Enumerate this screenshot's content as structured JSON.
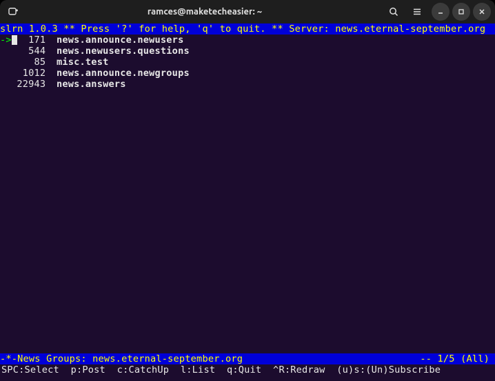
{
  "window": {
    "title": "ramces@maketecheasier: ~"
  },
  "header": "slrn 1.0.3 ** Press '?' for help, 'q' to quit. ** Server: news.eternal-september.org",
  "groups": [
    {
      "arrow": "->",
      "count": "171",
      "name": "news.announce.newusers",
      "cursor": true
    },
    {
      "arrow": "",
      "count": "544",
      "name": "news.newusers.questions",
      "cursor": false
    },
    {
      "arrow": "",
      "count": "85",
      "name": "misc.test",
      "cursor": false
    },
    {
      "arrow": "",
      "count": "1012",
      "name": "news.announce.newgroups",
      "cursor": false
    },
    {
      "arrow": "",
      "count": "22943",
      "name": "news.answers",
      "cursor": false
    }
  ],
  "status": {
    "left": "-*-News Groups: news.eternal-september.org",
    "right": "-- 1/5 (All)"
  },
  "help": "SPC:Select  p:Post  c:CatchUp  l:List  q:Quit  ^R:Redraw  (u)s:(Un)Subscribe"
}
